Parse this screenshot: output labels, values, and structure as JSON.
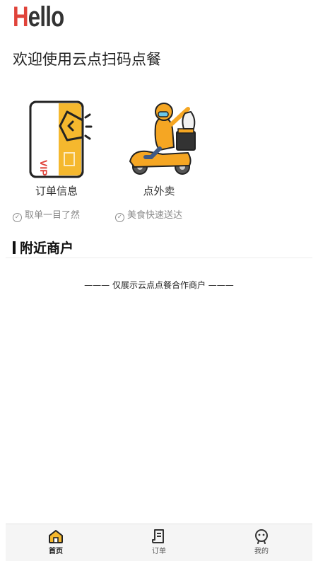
{
  "header": {
    "hello_first": "H",
    "hello_rest": "ello",
    "welcome": "欢迎使用云点扫码点餐"
  },
  "cards": [
    {
      "title": "订单信息",
      "subtitle": "取单一目了然",
      "icon": "vip-card-icon",
      "vip_text": "VIP"
    },
    {
      "title": "点外卖",
      "subtitle": "美食快速送达",
      "icon": "delivery-scooter-icon"
    }
  ],
  "section": {
    "title": "附近商户",
    "notice": "——— 仅展示云点点餐合作商户 ———"
  },
  "tabbar": [
    {
      "label": "首页",
      "icon": "home-icon",
      "active": true
    },
    {
      "label": "订单",
      "icon": "order-icon",
      "active": false
    },
    {
      "label": "我的",
      "icon": "profile-icon",
      "active": false
    }
  ],
  "colors": {
    "accent": "#f5b82e",
    "hello_red": "#e0433a",
    "text": "#222222"
  }
}
